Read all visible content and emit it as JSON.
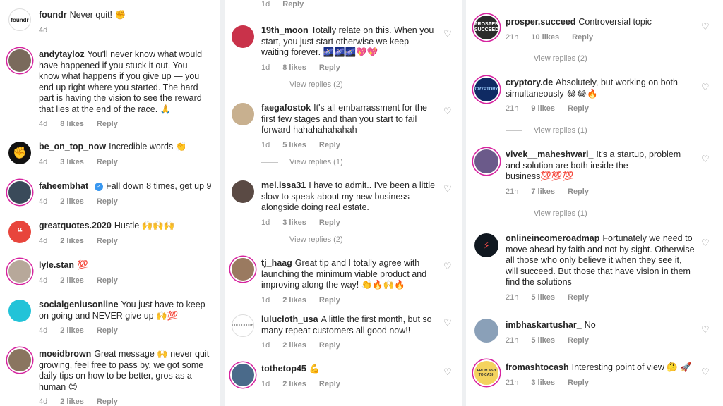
{
  "meta_labels": {
    "reply": "Reply"
  },
  "columns": [
    {
      "comments": [
        {
          "user": "foundr",
          "text": "Never quit! ✊",
          "time": "4d",
          "likes": ""
        },
        {
          "user": "andytayloz",
          "text": "You'll never know what would have happened if you stuck it out. You know what happens if you give up — you end up right where you started. The hard part is having the vision to see the reward that lies at the end of the race. 🙏",
          "time": "4d",
          "likes": "8 likes"
        },
        {
          "user": "be_on_top_now",
          "text": "Incredible words 👏",
          "time": "4d",
          "likes": "3 likes"
        },
        {
          "user": "faheembhat_",
          "text": "Fall down 8 times, get up 9",
          "time": "4d",
          "likes": "2 likes"
        },
        {
          "user": "greatquotes.2020",
          "text": "Hustle 🙌🙌🙌",
          "time": "4d",
          "likes": "2 likes"
        },
        {
          "user": "lyle.stan",
          "text": "💯",
          "time": "4d",
          "likes": "2 likes"
        },
        {
          "user": "socialgeniusonline",
          "text": "You just have to keep on going and NEVER give up 🙌💯",
          "time": "4d",
          "likes": "2 likes"
        },
        {
          "user": "moeidbrown",
          "text": "Great message 🙌 never quit growing, feel free to pass by, we got some daily tips on how to be better, gros as a human 😊",
          "time": "4d",
          "likes": "2 likes"
        }
      ]
    },
    {
      "top_meta": {
        "time": "1d",
        "reply": "Reply"
      },
      "comments": [
        {
          "user": "19th_moon",
          "text": "Totally relate on this. When you start, you just start otherwise we keep waiting forever. 🌌🌌🌌💖💖",
          "time": "1d",
          "likes": "8 likes",
          "view_replies": "View replies (2)"
        },
        {
          "user": "faegafostok",
          "text": "It's all embarrassment for the first few stages and than you start to fail forward hahahahahahah",
          "time": "1d",
          "likes": "5 likes",
          "view_replies": "View replies (1)"
        },
        {
          "user": "mel.issa31",
          "text": "I have to admit.. I've been a little slow to speak about my new business alongside doing real estate.",
          "time": "1d",
          "likes": "3 likes",
          "view_replies": "View replies (2)"
        },
        {
          "user": "tj_haag",
          "text": "Great tip and I totally agree with launching the minimum viable product and improving along the way! 👏🔥🙌🔥",
          "time": "1d",
          "likes": "2 likes"
        },
        {
          "user": "lulucloth_usa",
          "text": "A little the first month, but so many repeat customers all good now!!",
          "time": "1d",
          "likes": "2 likes"
        },
        {
          "user": "tothetop45",
          "text": "💪",
          "time": "1d",
          "likes": "2 likes"
        }
      ]
    },
    {
      "comments": [
        {
          "user": "prosper.succeed",
          "text": "Controversial topic",
          "time": "21h",
          "likes": "10 likes",
          "view_replies": "View replies (2)"
        },
        {
          "user": "cryptory.de",
          "text": "Absolutely, but working on both simultaneously 😂😂🔥",
          "time": "21h",
          "likes": "9 likes",
          "view_replies": "View replies (1)"
        },
        {
          "user": "vivek__maheshwari_",
          "text": "It's a startup, problem and solution are both inside the business💯💯💯",
          "time": "21h",
          "likes": "7 likes",
          "view_replies": "View replies (1)"
        },
        {
          "user": "onlineincomeroadmap",
          "text": "Fortunately we need to move ahead by faith and not by sight. Otherwise all those who only believe it when they see it, will succeed. But those that have vision in them find the solutions",
          "time": "21h",
          "likes": "5 likes"
        },
        {
          "user": "imbhaskartushar_",
          "text": "No",
          "time": "21h",
          "likes": "5 likes"
        },
        {
          "user": "fromashtocash",
          "text": "Interesting point of view 🤔 🚀",
          "time": "21h",
          "likes": "3 likes"
        }
      ]
    }
  ],
  "avatars": {
    "foundr": {
      "text": "foundr",
      "bg": "#ffffff",
      "fg": "#222222"
    },
    "prosper": {
      "text": "PROSPER SUCCEED",
      "bg": "#2b2b2b",
      "fg": "#ffffff"
    },
    "cryptory": {
      "text": "CRYPTORY",
      "bg": "#0f2a63",
      "fg": "#9fd0ff"
    },
    "lulucloth": {
      "text": "LULUCLOTH",
      "bg": "#ffffff",
      "fg": "#777777"
    },
    "fromash": {
      "text": "FROM ASH TO CASH",
      "bg": "#f4d35e",
      "fg": "#333333"
    }
  },
  "colors": {
    "text": "#262626",
    "meta": "#8e8e8e",
    "verified": "#3897f0",
    "story_ring": "#d6249f",
    "background": "#eef0f2"
  },
  "icons": {
    "heart": "♡",
    "verified": "✓"
  }
}
